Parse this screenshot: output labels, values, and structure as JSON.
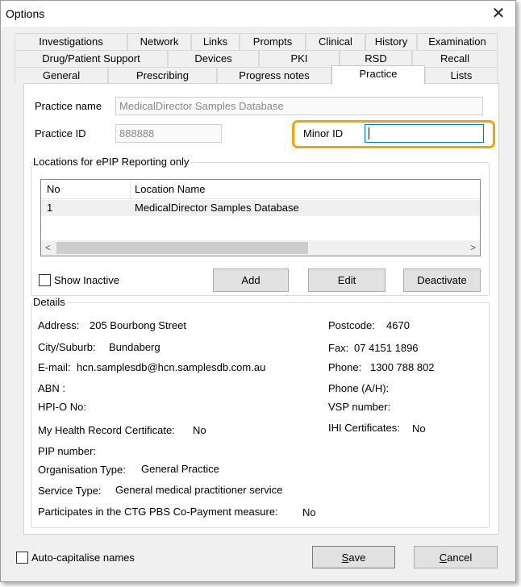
{
  "window": {
    "title": "Options",
    "close_glyph": "✕"
  },
  "tabs": {
    "row1": [
      "Investigations",
      "Network",
      "Links",
      "Prompts",
      "Clinical",
      "History",
      "Examination"
    ],
    "row2": [
      "Drug/Patient Support",
      "Devices",
      "PKI",
      "RSD",
      "Recall"
    ],
    "row3": [
      "General",
      "Prescribing",
      "Progress notes",
      "Practice",
      "Lists"
    ],
    "active": "Practice"
  },
  "practice": {
    "name_label": "Practice name",
    "name_value": "MedicalDirector Samples Database",
    "id_label": "Practice ID",
    "id_value": "888888",
    "minor_id_label": "Minor ID",
    "minor_id_value": ""
  },
  "locations": {
    "group_title": "Locations for ePIP Reporting only",
    "columns": [
      "No",
      "Location Name"
    ],
    "rows": [
      {
        "no": "1",
        "name": "MedicalDirector Samples Database"
      }
    ],
    "scroll_left": "<",
    "scroll_right": ">",
    "show_inactive_label": "Show Inactive",
    "add_label": "Add",
    "edit_label": "Edit",
    "deactivate_label": "Deactivate"
  },
  "details": {
    "group_title": "Details",
    "address_label": "Address:",
    "address_value": "205 Bourbong Street",
    "postcode_label": "Postcode:",
    "postcode_value": "4670",
    "city_label": "City/Suburb:",
    "city_value": "Bundaberg",
    "fax_label": "Fax:",
    "fax_value": "07 4151 1896",
    "email_label": "E-mail:",
    "email_value": "hcn.samplesdb@hcn.samplesdb.com.au",
    "phone_label": "Phone:",
    "phone_value": "1300 788 802",
    "abn_label": "ABN :",
    "phone_ah_label": "Phone (A/H):",
    "hpio_label": "HPI-O No:",
    "vsp_label": "VSP number:",
    "mhr_label": "My Health Record Certificate:",
    "mhr_value": "No",
    "ihi_label": "IHI Certificates:",
    "ihi_value": "No",
    "pip_label": "PIP number:",
    "org_type_label": "Organisation Type:",
    "org_type_value": "General Practice",
    "service_type_label": "Service Type:",
    "service_type_value": "General medical practitioner service",
    "ctg_label": "Participates in the CTG PBS Co-Payment measure:",
    "ctg_value": "No"
  },
  "footer": {
    "auto_cap_label": "Auto-capitalise names",
    "save_first": "S",
    "save_rest": "ave",
    "cancel_first": "C",
    "cancel_rest": "ancel"
  },
  "colors": {
    "highlight": "#f4a300",
    "window_bg": "#f0f0f0",
    "panel_bg": "#ffffff"
  }
}
